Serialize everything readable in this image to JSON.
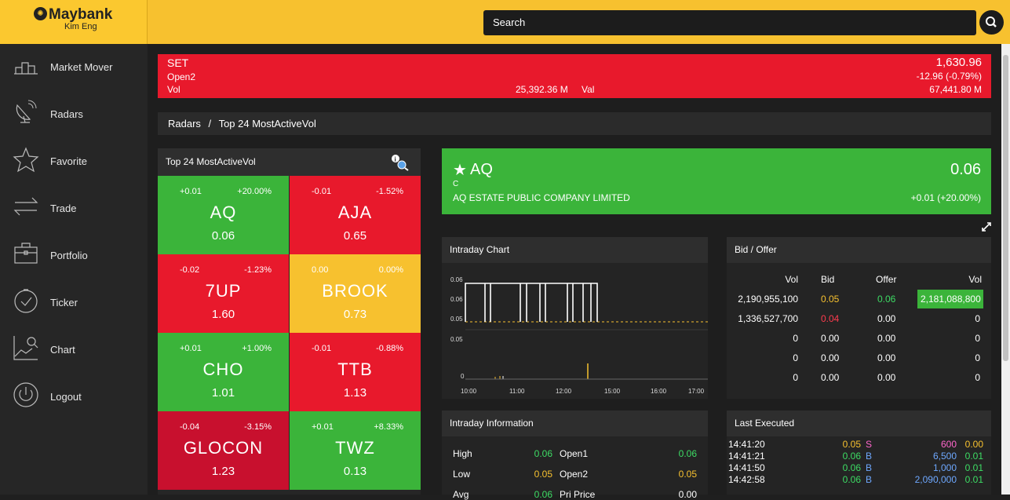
{
  "brand": {
    "name": "Maybank",
    "sub": "Kim Eng"
  },
  "search": {
    "placeholder": "Search"
  },
  "sidebar": {
    "items": [
      {
        "label": "Market Mover",
        "icon": "market-mover-icon"
      },
      {
        "label": "Radars",
        "icon": "radar-icon"
      },
      {
        "label": "Favorite",
        "icon": "star-icon"
      },
      {
        "label": "Trade",
        "icon": "trade-arrows-icon"
      },
      {
        "label": "Portfolio",
        "icon": "briefcase-icon"
      },
      {
        "label": "Ticker",
        "icon": "ticker-clock-icon"
      },
      {
        "label": "Chart",
        "icon": "chart-search-icon"
      },
      {
        "label": "Logout",
        "icon": "power-icon"
      }
    ]
  },
  "index": {
    "name": "SET",
    "session": "Open2",
    "vol_label": "Vol",
    "vol_value": "25,392.36 M",
    "val_label": "Val",
    "value": "1,630.96",
    "change": "-12.96 (-0.79%)",
    "val_value": "67,441.80 M"
  },
  "breadcrumb": {
    "root": "Radars",
    "separator": "/",
    "current": "Top 24 MostActiveVol"
  },
  "radar": {
    "title": "Top 24 MostActiveVol",
    "tiles": [
      {
        "chg": "+0.01",
        "pct": "+20.00%",
        "sym": "AQ",
        "price": "0.06",
        "color": "#3bb43a"
      },
      {
        "chg": "-0.01",
        "pct": "-1.52%",
        "sym": "AJA",
        "price": "0.65",
        "color": "#e8192c"
      },
      {
        "chg": "-0.02",
        "pct": "-1.23%",
        "sym": "7UP",
        "price": "1.60",
        "color": "#e8192c"
      },
      {
        "chg": "0.00",
        "pct": "0.00%",
        "sym": "BROOK",
        "price": "0.73",
        "color": "#f7c12f"
      },
      {
        "chg": "+0.01",
        "pct": "+1.00%",
        "sym": "CHO",
        "price": "1.01",
        "color": "#3bb43a"
      },
      {
        "chg": "-0.01",
        "pct": "-0.88%",
        "sym": "TTB",
        "price": "1.13",
        "color": "#e8192c"
      },
      {
        "chg": "-0.04",
        "pct": "-3.15%",
        "sym": "GLOCON",
        "price": "1.23",
        "color": "#c8102e"
      },
      {
        "chg": "+0.01",
        "pct": "+8.33%",
        "sym": "TWZ",
        "price": "0.13",
        "color": "#3bb43a"
      }
    ]
  },
  "stock": {
    "star": "★",
    "symbol": "AQ",
    "flag": "C",
    "company": "AQ ESTATE PUBLIC COMPANY LIMITED",
    "price": "0.06",
    "change": "+0.01 (+20.00%)"
  },
  "intraday_chart": {
    "title": "Intraday Chart",
    "y_labels": [
      "0.06",
      "0.06",
      "0.05"
    ],
    "vol_labels": [
      "0.05",
      "0"
    ],
    "x_labels": [
      "10:00",
      "11:00",
      "12:00",
      "15:00",
      "16:00",
      "17:00"
    ]
  },
  "bid_offer": {
    "title": "Bid / Offer",
    "headers": [
      "Vol",
      "Bid",
      "Offer",
      "Vol"
    ],
    "rows": [
      {
        "bid_vol": "2,190,955,100",
        "bid": "0.05",
        "offer": "0.06",
        "offer_vol": "2,181,088,800"
      },
      {
        "bid_vol": "1,336,527,700",
        "bid": "0.04",
        "offer": "0.00",
        "offer_vol": "0"
      },
      {
        "bid_vol": "0",
        "bid": "0.00",
        "offer": "0.00",
        "offer_vol": "0"
      },
      {
        "bid_vol": "0",
        "bid": "0.00",
        "offer": "0.00",
        "offer_vol": "0"
      },
      {
        "bid_vol": "0",
        "bid": "0.00",
        "offer": "0.00",
        "offer_vol": "0"
      }
    ]
  },
  "intraday_info": {
    "title": "Intraday Information",
    "rows": [
      {
        "l1": "High",
        "v1": "0.06",
        "l2": "Open1",
        "v2": "0.06"
      },
      {
        "l1": "Low",
        "v1": "0.05",
        "l2": "Open2",
        "v2": "0.05"
      },
      {
        "l1": "Avg",
        "v1": "0.06",
        "l2": "Pri Price",
        "v2": "0.00"
      }
    ]
  },
  "last_executed": {
    "title": "Last Executed",
    "rows": [
      {
        "time": "14:41:20",
        "price": "0.05",
        "side": "S",
        "vol": "600",
        "chg": "0.00"
      },
      {
        "time": "14:41:21",
        "price": "0.06",
        "side": "B",
        "vol": "6,500",
        "chg": "0.01"
      },
      {
        "time": "14:41:50",
        "price": "0.06",
        "side": "B",
        "vol": "1,000",
        "chg": "0.01"
      },
      {
        "time": "14:42:58",
        "price": "0.06",
        "side": "B",
        "vol": "2,090,000",
        "chg": "0.01"
      }
    ]
  }
}
